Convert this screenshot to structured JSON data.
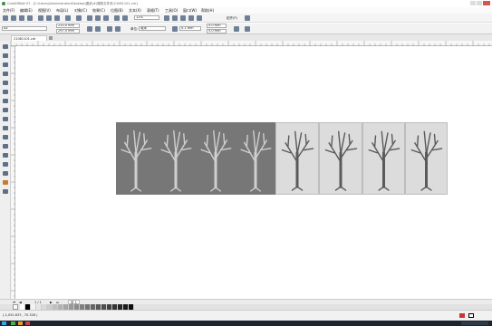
{
  "title_bar": {
    "title": "CorelDRAW X7 - [C:\\Users\\Administrator\\Desktop\\图纸\\#\\课程文件夹\\21081101.cdr]"
  },
  "menu": [
    "文件(F)",
    "编辑(E)",
    "视图(V)",
    "布局(L)",
    "对象(C)",
    "效果(C)",
    "位图(B)",
    "文本(X)",
    "表格(T)",
    "工具(O)",
    "窗口(W)",
    "帮助(H)"
  ],
  "toolbar": {
    "zoom": "12%",
    "snap_label": "贴齐(P)"
  },
  "property_bar": {
    "page_size": "A4",
    "width": "210.0 mm",
    "height": "297.0 mm",
    "units_label": "单位:",
    "units_value": "毫米",
    "nudge": "0.1 mm",
    "dup_x": "5.0 mm",
    "dup_y": "5.0 mm"
  },
  "document_tab": "21081101.cdr",
  "page_nav": {
    "page_count": "1 / 1",
    "page_tab": "页 1"
  },
  "status": {
    "coords": "(-1,051.633 , 70.326 )"
  },
  "tiles": {
    "count_dark": 4,
    "count_light": 4
  },
  "palette_colors": [
    "#ffffff",
    "#000000",
    "#f3f3f3",
    "#e6e6e6",
    "#d9d9d9",
    "#cccccc",
    "#bfbfbf",
    "#b3b3b3",
    "#a6a6a6",
    "#999999",
    "#8c8c8c",
    "#808080",
    "#737373",
    "#666666",
    "#595959",
    "#4d4d4d",
    "#404040",
    "#333333",
    "#262626",
    "#1a1a1a",
    "#0d0d0d"
  ],
  "colors": {
    "dark_tile": "#777777",
    "light_tile": "#dcdcdc",
    "dark_tree": "#cfcfcf",
    "light_tree": "#5a5a5a"
  }
}
